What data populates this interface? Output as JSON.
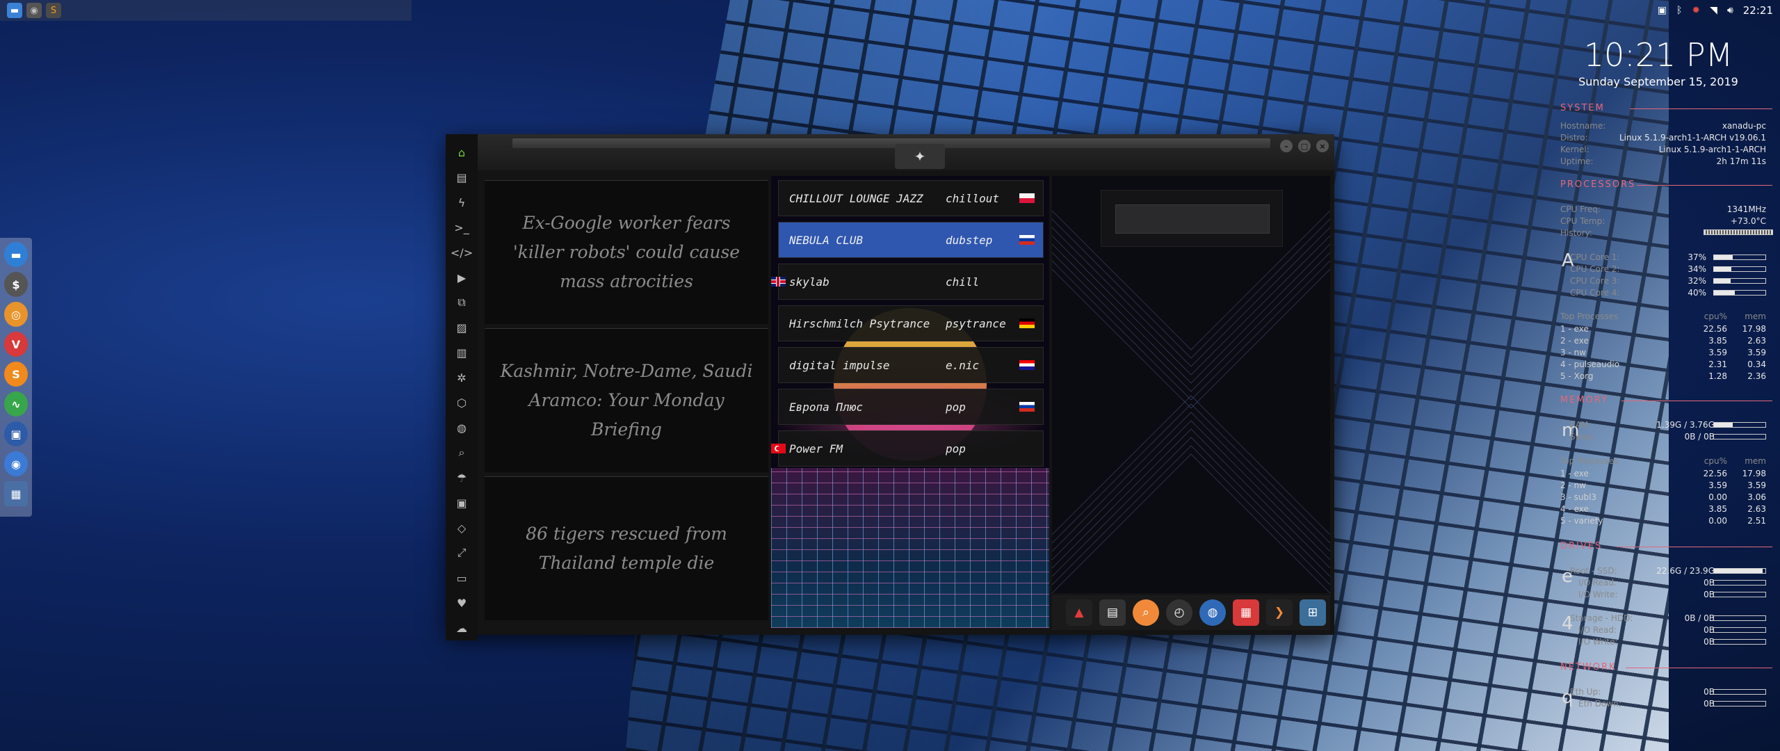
{
  "top_panel": {
    "clock": "22:21",
    "tray_icons": [
      "image-icon",
      "bluetooth-icon",
      "update-icon",
      "wifi-icon",
      "volume-icon"
    ]
  },
  "app": {
    "news": [
      "Ex-Google worker fears 'killer robots' could cause mass atrocities",
      "Kashmir, Notre-Dame, Saudi Aramco: Your Monday Briefing",
      "86 tigers rescued from Thailand temple die"
    ],
    "stations": [
      {
        "name": "CHILLOUT LOUNGE JAZZ",
        "genre": "chillout",
        "flag": "pl",
        "active": false
      },
      {
        "name": "NEBULA CLUB",
        "genre": "dubstep",
        "flag": "ru",
        "active": true
      },
      {
        "name": "skylab",
        "genre": "chill",
        "flag": "gb",
        "active": false
      },
      {
        "name": "Hirschmilch Psytrance",
        "genre": "psytrance",
        "flag": "de",
        "active": false
      },
      {
        "name": "digital impulse",
        "genre": "e.nic",
        "flag": "hr",
        "active": false
      },
      {
        "name": "Европа Плюс",
        "genre": "pop",
        "flag": "ru",
        "active": false
      },
      {
        "name": "Power FM",
        "genre": "pop",
        "flag": "tr",
        "active": false
      }
    ]
  },
  "conky": {
    "time": "10:21 PM",
    "date": "Sunday September 15, 2019",
    "system": {
      "title": "SYSTEM",
      "rows": [
        {
          "k": "Hostname:",
          "v": "xanadu-pc"
        },
        {
          "k": "Distro:",
          "v": "Linux 5.1.9-arch1-1-ARCH v19.06.1"
        },
        {
          "k": "Kernel:",
          "v": "Linux 5.1.9-arch1-1-ARCH"
        },
        {
          "k": "Uptime:",
          "v": "2h 17m 11s"
        }
      ]
    },
    "processors": {
      "title": "PROCESSORS",
      "rows": [
        {
          "k": "CPU Freq:",
          "v": "1341MHz"
        },
        {
          "k": "CPU Temp:",
          "v": "+73.0°C"
        },
        {
          "k": "History:",
          "v": ""
        }
      ],
      "glyph": "A",
      "cores": [
        {
          "k": "CPU Core 1:",
          "v": "37%",
          "pct": 37
        },
        {
          "k": "CPU Core 2:",
          "v": "34%",
          "pct": 34
        },
        {
          "k": "CPU Core 3:",
          "v": "32%",
          "pct": 32
        },
        {
          "k": "CPU Core 4:",
          "v": "40%",
          "pct": 40
        }
      ],
      "top_header": {
        "n": "Top Processes",
        "c1": "cpu%",
        "c2": "mem"
      },
      "top": [
        {
          "n": "1 - exe",
          "c1": "22.56",
          "c2": "17.98"
        },
        {
          "n": "2 - exe",
          "c1": "3.85",
          "c2": "2.63"
        },
        {
          "n": "3 - nw",
          "c1": "3.59",
          "c2": "3.59"
        },
        {
          "n": "4 - pulseaudio",
          "c1": "2.31",
          "c2": "0.34"
        },
        {
          "n": "5 - Xorg",
          "c1": "1.28",
          "c2": "2.36"
        }
      ]
    },
    "memory": {
      "title": "MEMORY",
      "glyph": "m",
      "rows": [
        {
          "k": "RAM:",
          "v": "1.39G / 3.76G",
          "pct": 37
        },
        {
          "k": "Swap:",
          "v": "0B / 0B",
          "pct": 0
        }
      ],
      "top_header": {
        "n": "Top Processes",
        "c1": "cpu%",
        "c2": "mem"
      },
      "top": [
        {
          "n": "1 - exe",
          "c1": "22.56",
          "c2": "17.98"
        },
        {
          "n": "2 - nw",
          "c1": "3.59",
          "c2": "3.59"
        },
        {
          "n": "3 - subl3",
          "c1": "0.00",
          "c2": "3.06"
        },
        {
          "n": "4 - exe",
          "c1": "3.85",
          "c2": "2.63"
        },
        {
          "n": "5 - variety",
          "c1": "0.00",
          "c2": "2.51"
        }
      ]
    },
    "drives": {
      "title": "DRIVES",
      "glyph1": "e",
      "root": [
        {
          "k": "Root - SSD:",
          "v": "22.6G / 23.9G",
          "pct": 95
        },
        {
          "k": "I/O Read:",
          "v": "0B",
          "pct": 0
        },
        {
          "k": "I/O Write:",
          "v": "0B",
          "pct": 0
        }
      ],
      "glyph2": "4",
      "storage": [
        {
          "k": "Storage - HDD:",
          "v": "0B / 0B",
          "pct": 0
        },
        {
          "k": "I/O Read:",
          "v": "0B",
          "pct": 0
        },
        {
          "k": "I/O Write:",
          "v": "0B",
          "pct": 0
        }
      ]
    },
    "network": {
      "title": "NETWORK",
      "glyph": "q",
      "rows": [
        {
          "k": "Eth Up:",
          "v": "0B",
          "pct": 0
        },
        {
          "k": "Eth Down:",
          "v": "0B",
          "pct": 0
        }
      ]
    }
  }
}
